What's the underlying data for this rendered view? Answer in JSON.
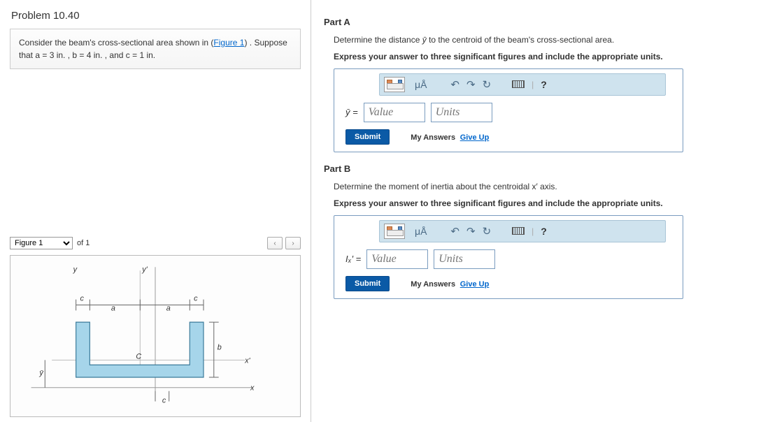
{
  "problem": {
    "title": "Problem 10.40",
    "body_before": "Consider the beam's cross-sectional area shown in (",
    "figure_link": "Figure 1",
    "body_after": ") . Suppose that a = 3  in. , b = 4  in. , and c = 1 in."
  },
  "figure": {
    "dropdown": "Figure 1",
    "of_text": "of 1",
    "prev": "‹",
    "next": "›"
  },
  "partA": {
    "title": "Part A",
    "prompt_before": "Determine the distance ",
    "prompt_var": "ȳ",
    "prompt_after": " to the centroid of the beam's cross-sectional area.",
    "instr": "Express your answer to three significant figures and include the appropriate units.",
    "var_label": "ȳ =",
    "value_ph": "Value",
    "units_ph": "Units",
    "submit": "Submit",
    "my_answers": "My Answers",
    "give_up": "Give Up"
  },
  "partB": {
    "title": "Part B",
    "prompt": "Determine the moment of inertia about the centroidal x′ axis.",
    "instr": "Express your answer to three significant figures and include the appropriate units.",
    "var_label": "Iₓ′ =",
    "value_ph": "Value",
    "units_ph": "Units",
    "submit": "Submit",
    "my_answers": "My Answers",
    "give_up": "Give Up"
  },
  "toolbar": {
    "mua": "μÅ",
    "undo": "↶",
    "redo": "↷",
    "reset": "↻",
    "pipe": "|",
    "help": "?"
  }
}
